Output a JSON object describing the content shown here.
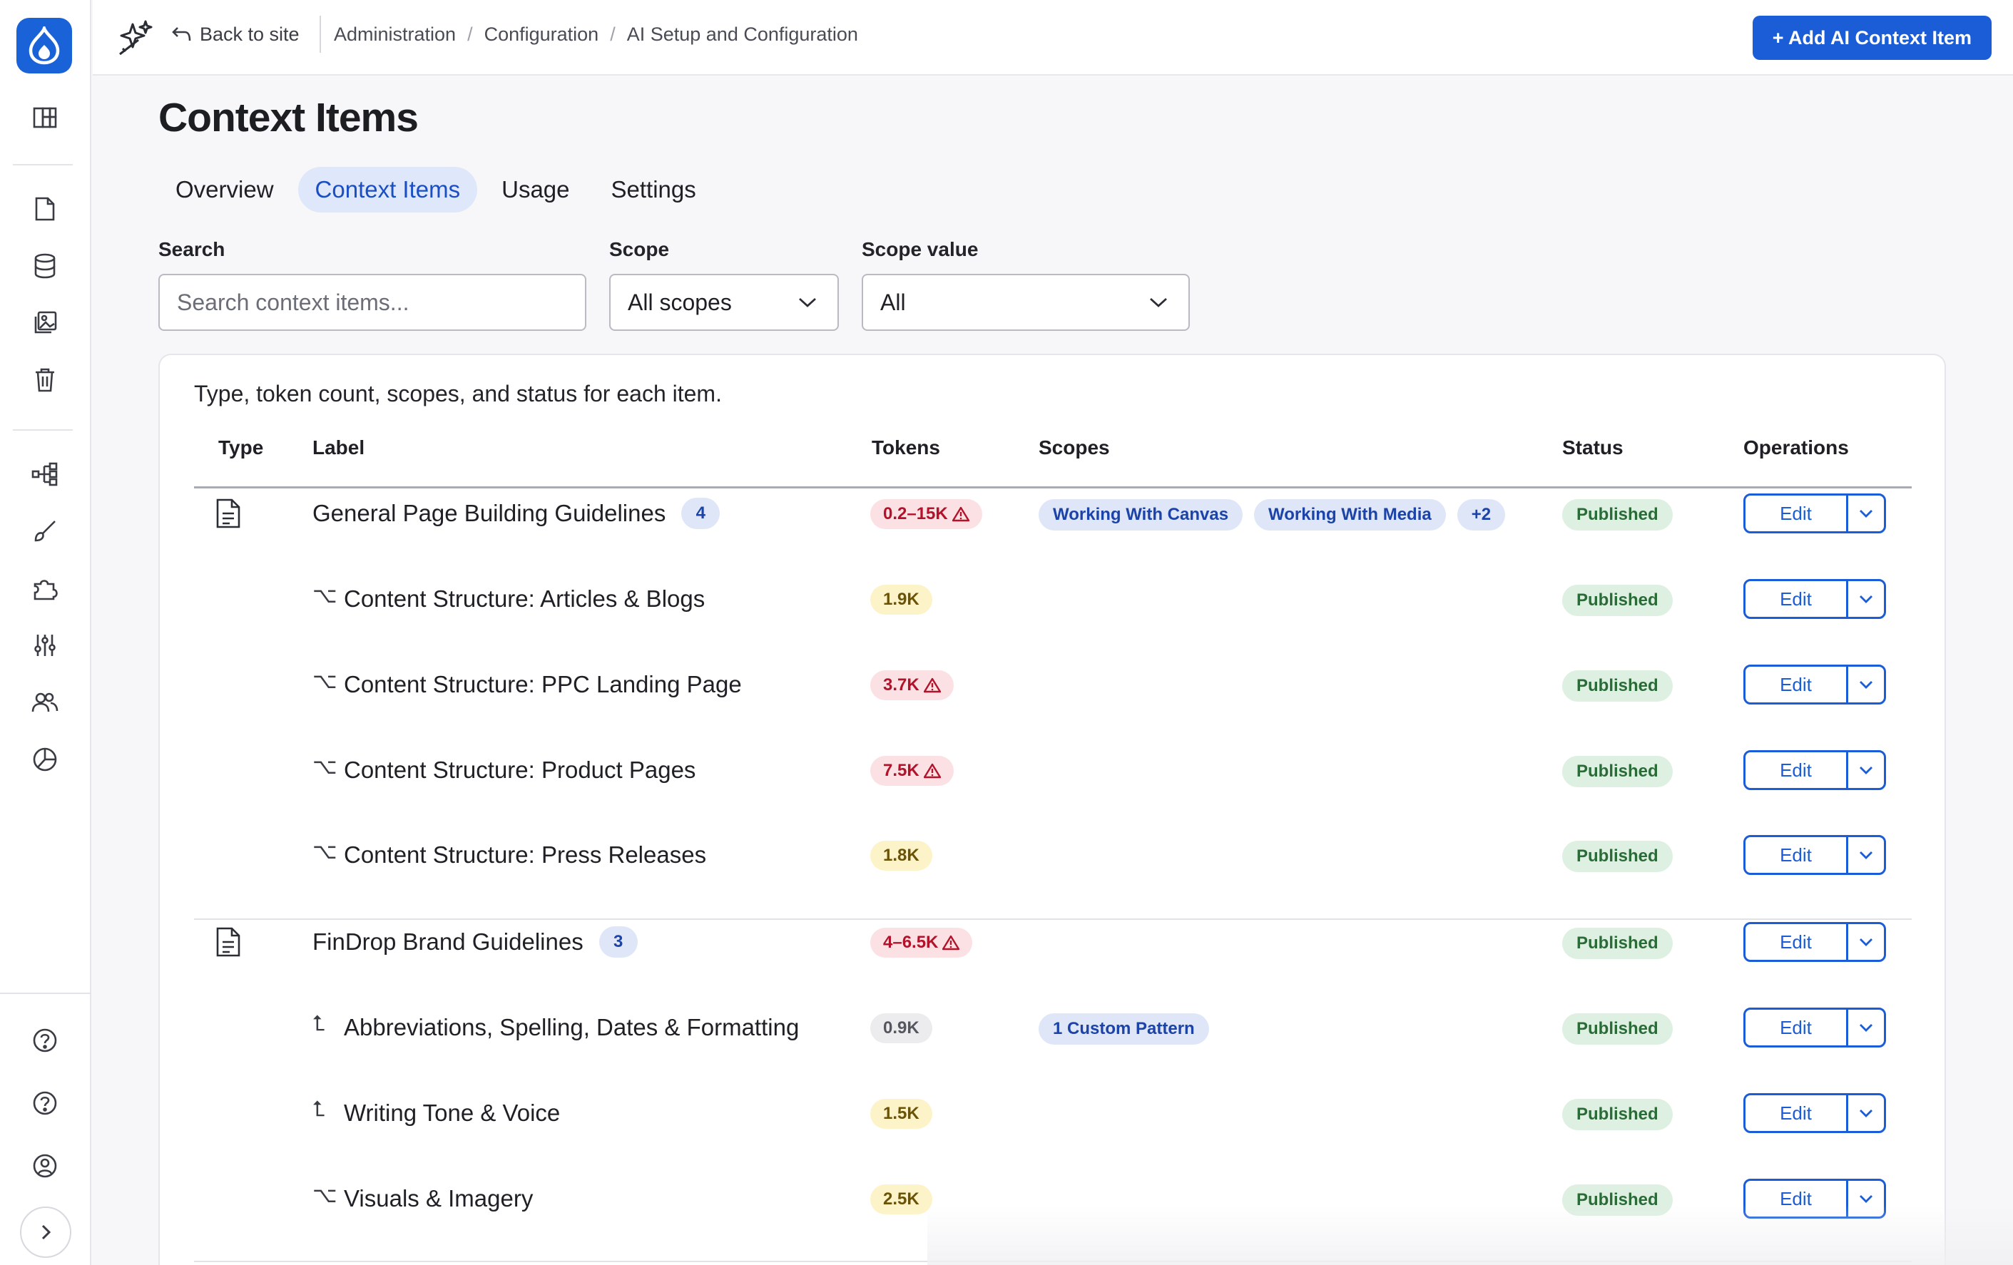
{
  "topbar": {
    "back_label": "Back to site",
    "breadcrumb": [
      "Administration",
      "Configuration",
      "AI Setup and Configuration"
    ],
    "breadcrumb_separator": "/",
    "add_button_label": "+ Add AI Context Item"
  },
  "rail": {
    "icons": [
      "drupal-logo-icon",
      "dashboard-icon",
      "content-icon",
      "database-icon",
      "media-icon",
      "trash-icon",
      "structure-icon",
      "appearance-icon",
      "extend-icon",
      "configuration-icon",
      "people-icon",
      "reports-icon",
      "help-icon",
      "help-circle-icon",
      "user-account-icon",
      "expand-icon"
    ]
  },
  "page": {
    "title": "Context Items",
    "tabs": [
      {
        "label": "Overview",
        "active": false
      },
      {
        "label": "Context Items",
        "active": true
      },
      {
        "label": "Usage",
        "active": false
      },
      {
        "label": "Settings",
        "active": false
      }
    ]
  },
  "filters": {
    "search_label": "Search",
    "search_placeholder": "Search context items...",
    "scope_label": "Scope",
    "scope_value": "All scopes",
    "scope_value_label": "Scope value",
    "scope_value_value": "All"
  },
  "table": {
    "caption": "Type, token count, scopes, and status for each item.",
    "headers": {
      "type": "Type",
      "label": "Label",
      "tokens": "Tokens",
      "scopes": "Scopes",
      "status": "Status",
      "operations": "Operations"
    },
    "edit_label": "Edit",
    "rows": [
      {
        "kind": "parent",
        "label": "General Page Building Guidelines",
        "count": "4",
        "tokens": "0.2–15K",
        "token_level": "red",
        "warning": true,
        "scopes": [
          "Working With Canvas",
          "Working With Media",
          "+2"
        ],
        "status": "Published"
      },
      {
        "kind": "child",
        "connector": "⌥",
        "label": "Content Structure: Articles & Blogs",
        "tokens": "1.9K",
        "token_level": "yellow",
        "warning": false,
        "scopes": [],
        "status": "Published"
      },
      {
        "kind": "child",
        "connector": "⌥",
        "label": "Content Structure: PPC Landing Page",
        "tokens": "3.7K",
        "token_level": "red",
        "warning": true,
        "scopes": [],
        "status": "Published"
      },
      {
        "kind": "child",
        "connector": "⌥",
        "label": "Content Structure: Product Pages",
        "tokens": "7.5K",
        "token_level": "red",
        "warning": true,
        "scopes": [],
        "status": "Published"
      },
      {
        "kind": "child",
        "connector": "⌥",
        "label": "Content Structure: Press Releases",
        "tokens": "1.8K",
        "token_level": "yellow",
        "warning": false,
        "scopes": [],
        "status": "Published"
      },
      {
        "kind": "parent",
        "label": "FinDrop Brand Guidelines",
        "count": "3",
        "tokens": "4–6.5K",
        "token_level": "red",
        "warning": true,
        "scopes": [],
        "status": "Published"
      },
      {
        "kind": "child",
        "connector": "⮤",
        "label": "Abbreviations, Spelling, Dates & Formatting",
        "tokens": "0.9K",
        "token_level": "gray",
        "warning": false,
        "scopes": [
          "1 Custom Pattern"
        ],
        "status": "Published"
      },
      {
        "kind": "child",
        "connector": "⮤",
        "label": "Writing Tone & Voice",
        "tokens": "1.5K",
        "token_level": "yellow",
        "warning": false,
        "scopes": [],
        "status": "Published"
      },
      {
        "kind": "child",
        "connector": "⌥",
        "label": "Visuals & Imagery",
        "tokens": "2.5K",
        "token_level": "yellow",
        "warning": false,
        "scopes": [],
        "status": "Published"
      }
    ]
  },
  "colors": {
    "accent": "#1a5dd6",
    "brand": "#1a62d8",
    "token_red_bg": "#fbe1e3",
    "token_yellow_bg": "#fdf3c8",
    "token_gray_bg": "#ececef",
    "status_published_bg": "#def0e2",
    "scope_bg": "#dfe6f8"
  }
}
